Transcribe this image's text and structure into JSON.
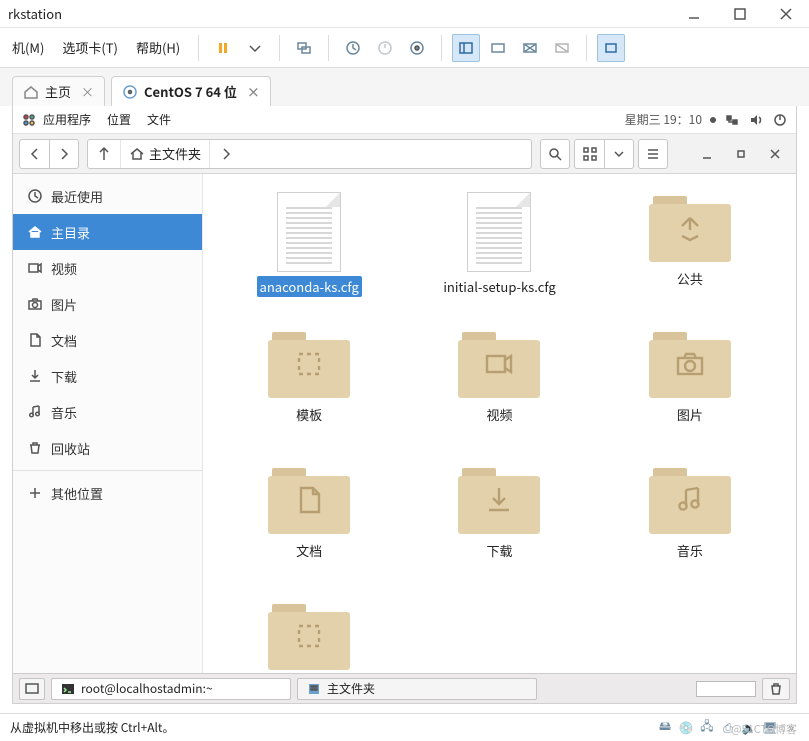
{
  "window": {
    "title": "rkstation"
  },
  "vmware": {
    "menu": [
      "机(M)",
      "选项卡(T)",
      "帮助(H)"
    ],
    "tabs": [
      {
        "icon": "home",
        "label": "主页"
      },
      {
        "icon": "disc",
        "label": "CentOS 7 64 位",
        "active": true
      }
    ]
  },
  "gnome_top": {
    "apps": "应用程序",
    "places": "位置",
    "files": "文件",
    "clock": "星期三 19：10"
  },
  "nautilus": {
    "path": {
      "label": "主文件夹"
    },
    "sidebar": [
      {
        "id": "recent",
        "icon": "clock",
        "label": "最近使用"
      },
      {
        "id": "home",
        "icon": "home",
        "label": "主目录",
        "selected": true
      },
      {
        "id": "videos",
        "icon": "video",
        "label": "视频"
      },
      {
        "id": "pictures",
        "icon": "camera",
        "label": "图片"
      },
      {
        "id": "documents",
        "icon": "doc",
        "label": "文档"
      },
      {
        "id": "downloads",
        "icon": "download",
        "label": "下载"
      },
      {
        "id": "music",
        "icon": "music",
        "label": "音乐"
      },
      {
        "id": "trash",
        "icon": "trash",
        "label": "回收站"
      },
      {
        "id": "other",
        "icon": "plus",
        "label": "其他位置",
        "sep_before": true
      }
    ],
    "files": [
      {
        "type": "file",
        "name": "anaconda-ks.cfg",
        "selected": true
      },
      {
        "type": "file",
        "name": "initial-setup-ks.cfg"
      },
      {
        "type": "folder",
        "name": "公共",
        "glyph": "share"
      },
      {
        "type": "folder",
        "name": "模板",
        "glyph": "template"
      },
      {
        "type": "folder",
        "name": "视频",
        "glyph": "video"
      },
      {
        "type": "folder",
        "name": "图片",
        "glyph": "camera"
      },
      {
        "type": "folder",
        "name": "文档",
        "glyph": "doc"
      },
      {
        "type": "folder",
        "name": "下载",
        "glyph": "download"
      },
      {
        "type": "folder",
        "name": "音乐",
        "glyph": "music"
      },
      {
        "type": "folder",
        "name": "",
        "glyph": "template"
      }
    ]
  },
  "panel": {
    "term": "root@localhostadmin:~",
    "fm": "主文件夹"
  },
  "vm_status": "从虚拟机中移出或按 Ctrl+Alt。",
  "watermark": "@51CTO博客"
}
